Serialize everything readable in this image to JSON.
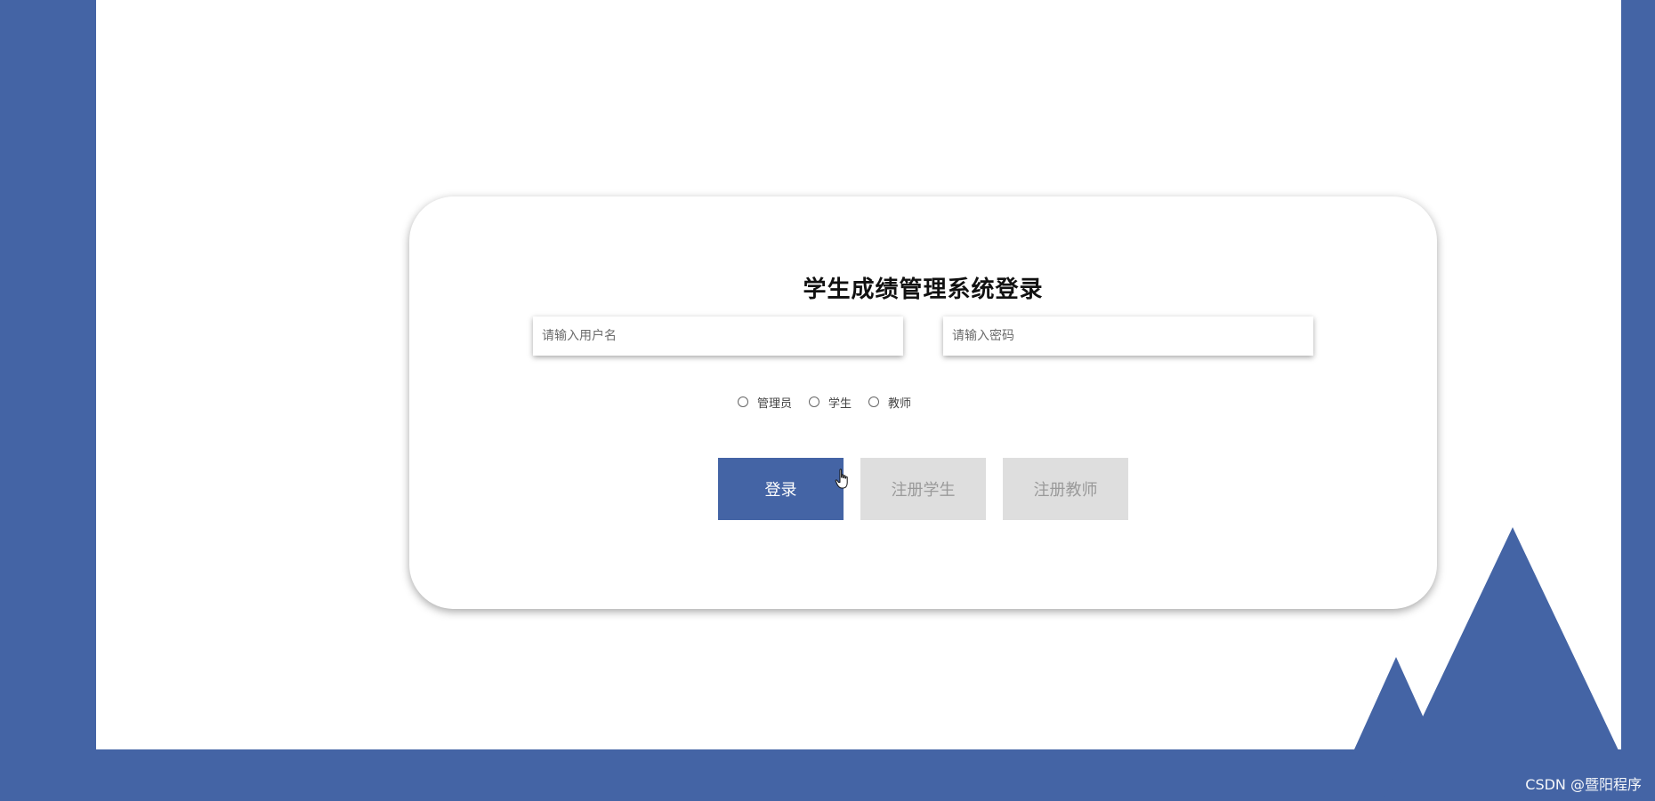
{
  "login": {
    "title": "学生成绩管理系统登录",
    "username_placeholder": "请输入用户名",
    "password_placeholder": "请输入密码",
    "roles": [
      {
        "label": "管理员"
      },
      {
        "label": "学生"
      },
      {
        "label": "教师"
      }
    ],
    "buttons": {
      "login": "登录",
      "register_student": "注册学生",
      "register_teacher": "注册教师"
    }
  },
  "watermark": "CSDN @暨阳程序",
  "colors": {
    "brand": "#4464a5",
    "button_disabled_bg": "#dedede",
    "button_disabled_text": "#9a9a9a",
    "card_bg": "#ffffff"
  },
  "icons": {
    "cursor": "hand-pointer-icon",
    "radio": "radio-unchecked-icon"
  }
}
